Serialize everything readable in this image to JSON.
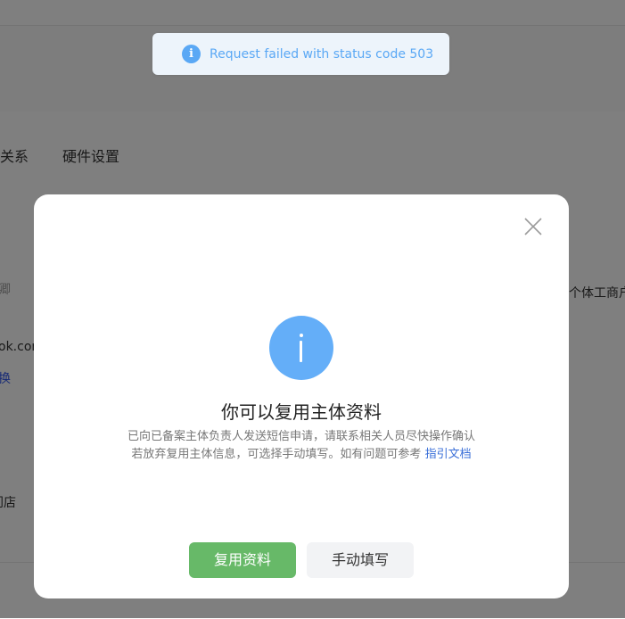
{
  "background": {
    "tabs": [
      "关系",
      "硬件设置"
    ],
    "left_fragments": [
      "卿",
      "ok.com",
      "换",
      "门店"
    ],
    "right_fragment": "个体工商户"
  },
  "toast": {
    "icon": "info-icon",
    "message": "Request failed with status code 503",
    "color": "#5aa8f5"
  },
  "modal": {
    "close_icon": "close-icon",
    "icon": "info-circle-icon",
    "title": "你可以复用主体资料",
    "desc_line1": "已向已备案主体负责人发送短信申请，请联系相关人员尽快操作确认",
    "desc_line2": "若放弃复用主体信息，可选择手动填写。如有问题可参考",
    "guide_link": "指引文档",
    "primary_button": "复用资料",
    "secondary_button": "手动填写",
    "primary_color": "#67b968",
    "link_color": "#3a6fd8"
  }
}
